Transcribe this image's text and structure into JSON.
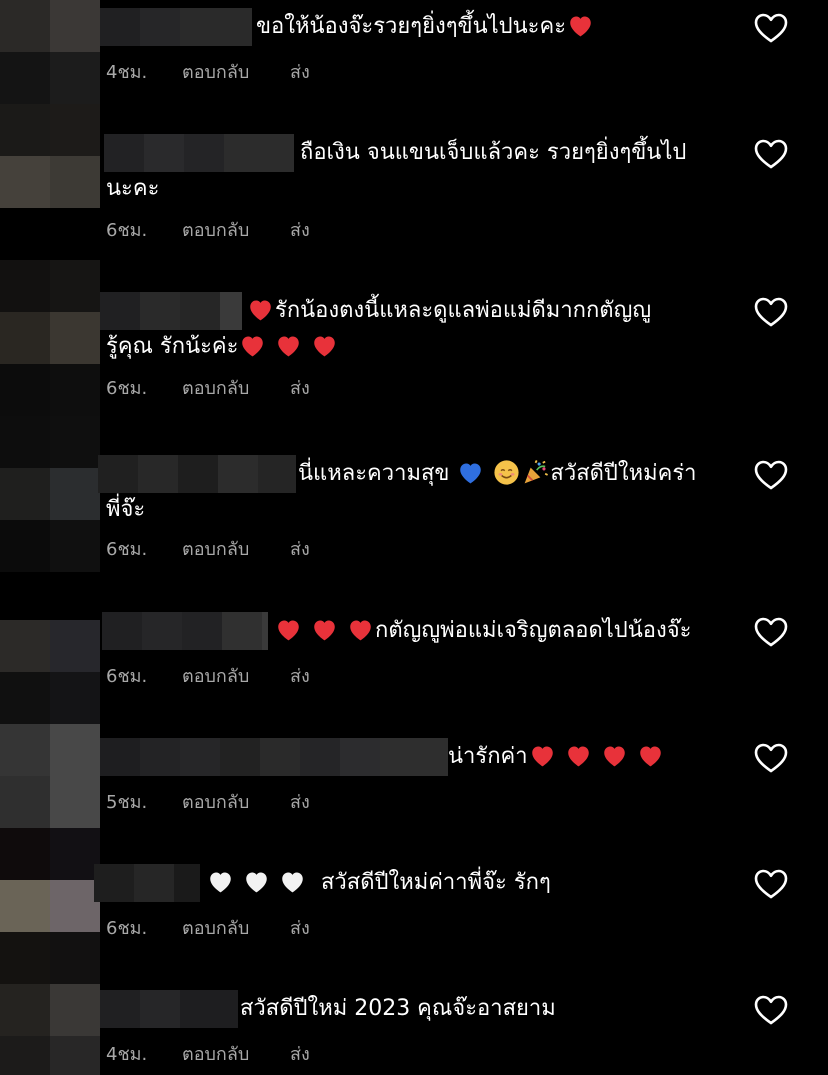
{
  "actions": {
    "reply": "ตอบกลับ",
    "send": "ส่ง"
  },
  "icons": {
    "like": "heart-outline-icon",
    "emoji_red": "red-heart-emoji",
    "emoji_blue": "blue-heart-emoji",
    "emoji_white": "white-heart-emoji",
    "emoji_smile": "smiling-face-emoji",
    "emoji_party": "party-popper-emoji"
  },
  "colors": {
    "background": "#000000",
    "text": "#ffffff",
    "meta": "#a8a8a8",
    "red_heart": "#e8323a",
    "blue_heart": "#2f6fe0",
    "white_heart": "#f2f2f2"
  },
  "comments": [
    {
      "line1": "ขอให้น้องจ๊ะรวยๆยิ่งๆขึ้นไปนะคะ",
      "time": "4ชม."
    },
    {
      "line1": "ถือเงิน จนแขนเจ็บแล้วคะ  รวยๆยิ่งๆขึ้นไป",
      "line2": "นะคะ",
      "time": "6ชม."
    },
    {
      "line1": "รักน้องตงนี้แหละดูแลพ่อแม่ดีมากกตัญญู",
      "line2": "รู้คุณ รักน้ะค่ะ",
      "time": "6ชม."
    },
    {
      "line1a": "นี่แหละความสุข",
      "line1b": "สวัสดีปีใหม่คร่า",
      "line2": "พี่จ๊ะ",
      "time": "6ชม."
    },
    {
      "line1": "กตัญญูพ่อแม่เจริญตลอดไปน้องจ๊ะ",
      "time": "6ชม."
    },
    {
      "line1": "น่ารักค่า",
      "time": "5ชม."
    },
    {
      "line1": "สวัสดีปีใหม่ค่าาพี่จ๊ะ  รักๆ",
      "time": "6ชม."
    },
    {
      "line1": "สวัสดีปีใหม่  2023  คุณจ๊ะอาสยาม",
      "time": "4ชม."
    }
  ]
}
